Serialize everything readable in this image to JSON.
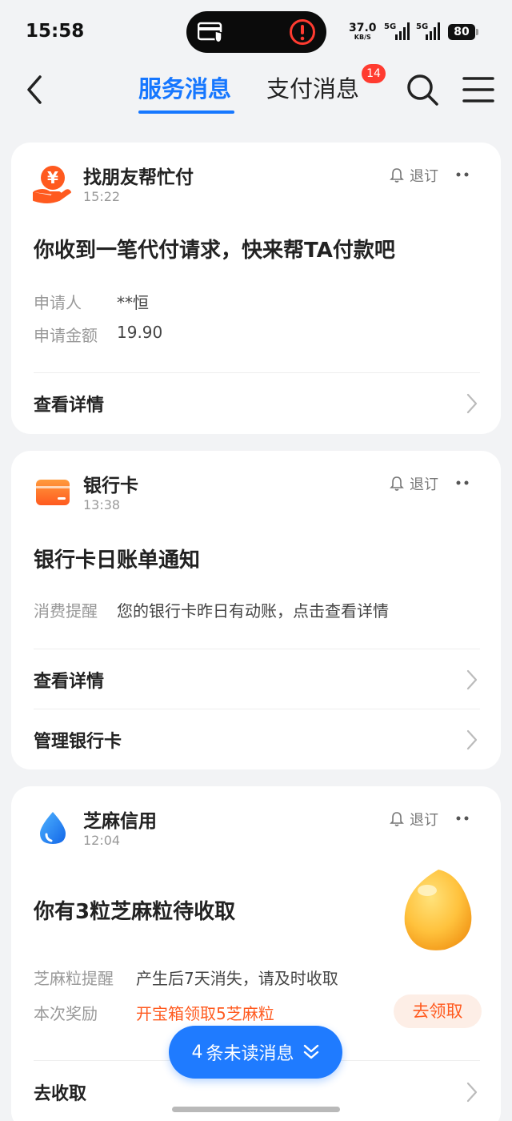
{
  "status_bar": {
    "time": "15:58",
    "net_speed": "37.0",
    "net_unit": "KB/S",
    "signal1": "5G",
    "signal2": "5G",
    "battery": "80"
  },
  "nav": {
    "tabs": [
      {
        "label": "服务消息",
        "active": true
      },
      {
        "label": "支付消息",
        "active": false,
        "badge": "14"
      }
    ]
  },
  "cards": [
    {
      "service": "找朋友帮忙付",
      "time": "15:22",
      "unsubscribe": "退订",
      "headline": "你收到一笔代付请求，快来帮TA付款吧",
      "rows": [
        {
          "k": "申请人",
          "v": "**恒"
        },
        {
          "k": "申请金额",
          "v": "19.90"
        }
      ],
      "links": [
        "查看详情"
      ]
    },
    {
      "service": "银行卡",
      "time": "13:38",
      "unsubscribe": "退订",
      "headline": "银行卡日账单通知",
      "rows": [
        {
          "k": "消费提醒",
          "v": "您的银行卡昨日有动账，点击查看详情"
        }
      ],
      "links": [
        "查看详情",
        "管理银行卡"
      ]
    },
    {
      "service": "芝麻信用",
      "time": "12:04",
      "unsubscribe": "退订",
      "headline": "你有3粒芝麻粒待收取",
      "rows": [
        {
          "k": "芝麻粒提醒",
          "v": "产生后7天消失，请及时收取"
        },
        {
          "k": "本次奖励",
          "v": "开宝箱领取5芝麻粒"
        }
      ],
      "action": "去领取",
      "links": [
        "去收取"
      ]
    }
  ],
  "unread": {
    "count": "4",
    "label": "条未读消息"
  },
  "colors": {
    "accent": "#1677ff",
    "orange": "#ff5a1f",
    "badge": "#ff3b30"
  }
}
